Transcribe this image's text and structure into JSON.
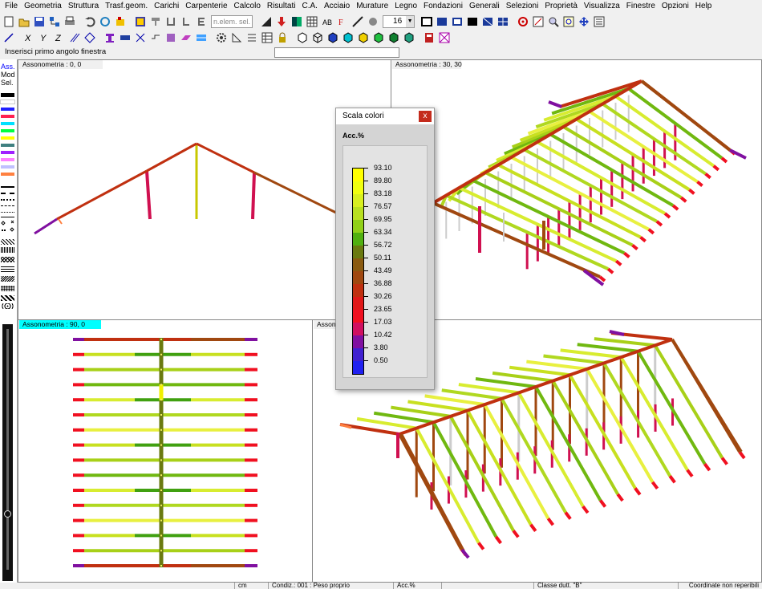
{
  "menu": [
    "File",
    "Geometria",
    "Struttura",
    "Trasf.geom.",
    "Carichi",
    "Carpenterie",
    "Calcolo",
    "Risultati",
    "C.A.",
    "Acciaio",
    "Murature",
    "Legno",
    "Fondazioni",
    "Generali",
    "Selezioni",
    "Proprietà",
    "Visualizza",
    "Finestre",
    "Opzioni",
    "Help"
  ],
  "toolbar": {
    "elem_sel_placeholder": "n.elem. sel.",
    "font_size_value": "16"
  },
  "status_prompt": "Inserisci primo angolo finestra",
  "palette": {
    "labels": [
      "Ass.",
      "Mod",
      "Sel."
    ],
    "swatches": [
      "#000000",
      "#ffffff",
      "#2020ff",
      "#ff2050",
      "#00e0ff",
      "#00ff40",
      "#ffff00",
      "#408080",
      "#a020ff",
      "#ff80ff",
      "#c0c0ff",
      "#ff8040"
    ]
  },
  "viewports": {
    "top_left": {
      "label": "Assonometria :  0, 0"
    },
    "top_right": {
      "label": "Assonometria :  30, 30"
    },
    "bottom_left": {
      "label": "Assonometria :  90, 0"
    },
    "bottom_right": {
      "label": "Assono"
    }
  },
  "scala": {
    "title": "Scala colori",
    "close": "x",
    "heading": "Acc.%",
    "entries": [
      {
        "value": "93.10",
        "color": "#ffff00"
      },
      {
        "value": "89.80",
        "color": "#f0ff10"
      },
      {
        "value": "83.18",
        "color": "#d8f020"
      },
      {
        "value": "76.57",
        "color": "#b8e020"
      },
      {
        "value": "69.95",
        "color": "#90d018"
      },
      {
        "value": "63.34",
        "color": "#50b010"
      },
      {
        "value": "56.72",
        "color": "#6a7a10"
      },
      {
        "value": "50.11",
        "color": "#8a5a10"
      },
      {
        "value": "43.49",
        "color": "#a04810"
      },
      {
        "value": "36.88",
        "color": "#c03010"
      },
      {
        "value": "30.26",
        "color": "#e01818"
      },
      {
        "value": "23.65",
        "color": "#f01020"
      },
      {
        "value": "17.03",
        "color": "#d01060"
      },
      {
        "value": "10.42",
        "color": "#8010a0"
      },
      {
        "value": "3.80",
        "color": "#4020d0"
      },
      {
        "value": "0.50",
        "color": "#2020f0"
      }
    ]
  },
  "statusbar": {
    "units": "cm",
    "condition": "Condiz.: 001 : Peso proprio",
    "result": "Acc.%",
    "ductility": "Classe dutt. \"B\"",
    "coords": "Coordinate non reperibili"
  }
}
